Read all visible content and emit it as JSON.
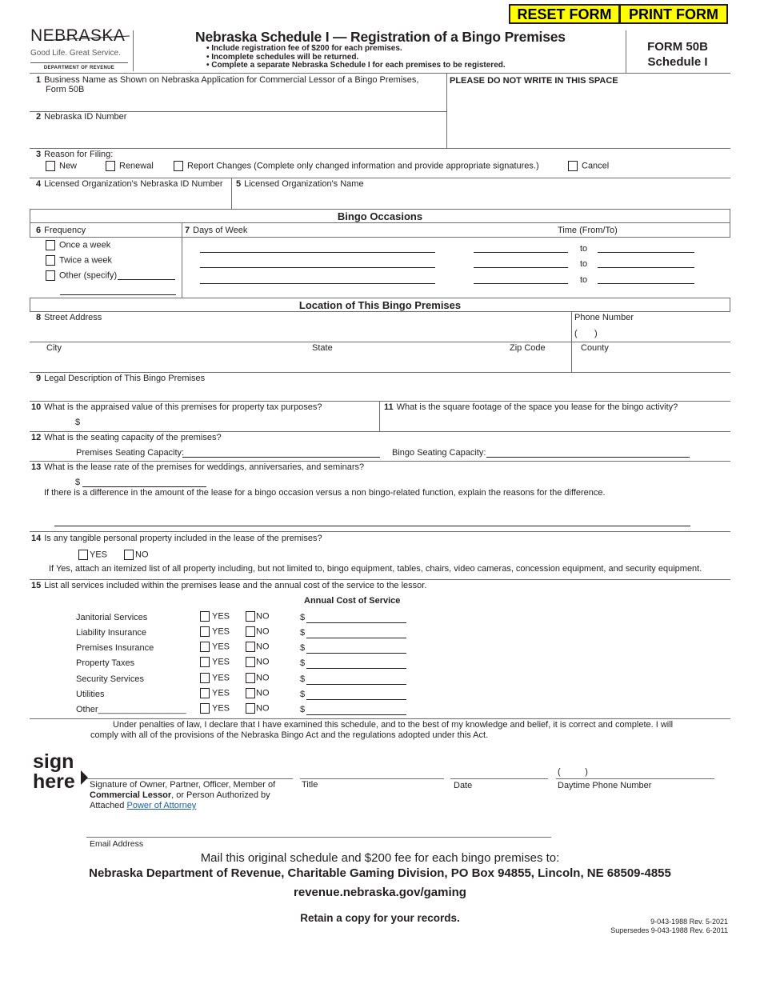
{
  "toolbar": {
    "reset_label": "RESET FORM",
    "print_label": "PRINT FORM",
    "button_color": "#ffff00"
  },
  "header": {
    "logo_text": "NEBRASKA",
    "logo_tagline": "Good Life. Great Service.",
    "logo_dept": "DEPARTMENT OF REVENUE",
    "title": "Nebraska Schedule I — Registration of a Bingo Premises",
    "bullets": [
      "Include registration fee of $200 for each premises.",
      "Incomplete schedules will be returned.",
      "Complete a separate Nebraska Schedule I for each premises to be registered."
    ],
    "form_number": "FORM 50B",
    "form_schedule": "Schedule I"
  },
  "fields": {
    "f1": {
      "num": "1",
      "label": "Business Name as Shown on Nebraska Application for Commercial Lessor of a Bingo Premises,",
      "label2": "Form 50B",
      "value": ""
    },
    "office_use": "PLEASE DO NOT WRITE IN THIS SPACE",
    "f2": {
      "num": "2",
      "label": "Nebraska ID Number",
      "value": ""
    },
    "f3": {
      "num": "3",
      "label": "Reason for Filing:",
      "options": [
        {
          "label": "New",
          "checked": false
        },
        {
          "label": "Renewal",
          "checked": false
        },
        {
          "label": "Report Changes (Complete only changed information and provide appropriate signatures.)",
          "checked": false
        },
        {
          "label": "Cancel",
          "checked": false
        }
      ]
    },
    "f4": {
      "num": "4",
      "label": "Licensed Organization's Nebraska ID Number",
      "value": ""
    },
    "f5": {
      "num": "5",
      "label": "Licensed Organization's Name",
      "value": ""
    }
  },
  "bingo_occasions": {
    "heading": "Bingo Occasions",
    "f6": {
      "num": "6",
      "label": "Frequency",
      "options": [
        {
          "label": "Once a week",
          "checked": false
        },
        {
          "label": "Twice a week",
          "checked": false
        },
        {
          "label": "Other (specify)",
          "checked": false
        }
      ]
    },
    "f7": {
      "num": "7",
      "label": "Days of Week"
    },
    "time_label": "Time (From/To)",
    "to_label": "to"
  },
  "location": {
    "heading": "Location of This Bingo Premises",
    "f8": {
      "num": "8",
      "label": "Street Address",
      "value": ""
    },
    "phone_label": "Phone Number",
    "phone_parens": "(       )",
    "city_label": "City",
    "state_label": "State",
    "zip_label": "Zip Code",
    "county_label": "County",
    "f9": {
      "num": "9",
      "label": "Legal Description of This Bingo Premises"
    },
    "f10": {
      "num": "10",
      "label": "What is the appraised value of this premises for property tax purposes?",
      "currency": "$"
    },
    "f11": {
      "num": "11",
      "label": "What is the square footage of the space you lease for the bingo activity?"
    },
    "f12": {
      "num": "12",
      "label": "What is the seating capacity of the premises?",
      "premises_label": "Premises Seating Capacity:",
      "bingo_label": "Bingo Seating Capacity:"
    },
    "f13": {
      "num": "13",
      "label": "What is the lease rate of the premises for weddings, anniversaries, and seminars?",
      "currency": "$",
      "explain": "If there is a difference in the amount of the lease for a bingo occasion versus a non bingo-related function, explain the reasons for the difference."
    },
    "f14": {
      "num": "14",
      "label": "Is any tangible personal property included in the lease of the premises?",
      "yes": "YES",
      "no": "NO",
      "note": "If Yes, attach an itemized list of all property including, but not limited to, bingo equipment, tables, chairs, video cameras, concession equipment, and security equipment."
    },
    "f15": {
      "num": "15",
      "label": "List all services included within the premises lease and the annual cost of the service to the lessor.",
      "cost_header": "Annual Cost of Service",
      "yes": "YES",
      "no": "NO",
      "currency": "$",
      "services": [
        "Janitorial Services",
        "Liability Insurance",
        "Premises Insurance",
        "Property Taxes",
        "Security Services",
        "Utilities",
        "Other__________________"
      ]
    }
  },
  "signature": {
    "declaration": "Under penalties of law, I declare that I have examined this schedule, and to the best of my knowledge and belief, it is correct and complete. I will",
    "declaration2": "comply with all of the provisions of the Nebraska Bingo Act and the regulations adopted under this Act.",
    "sign": "sign",
    "here": "here",
    "sig_label1": "Signature of Owner, Partner, Officer, Member of",
    "sig_label2_bold": "Commercial Lessor",
    "sig_label2_rest": ", or Person Authorized by",
    "sig_label3": "Attached ",
    "poa_link": "Power of Attorney",
    "title_label": "Title",
    "date_label": "Date",
    "phone_parens": "(          )",
    "phone_label": "Daytime Phone Number",
    "email_label": "Email Address"
  },
  "footer": {
    "mail_line": "Mail this original schedule and $200 fee for each bingo premises to:",
    "address": "Nebraska Department of Revenue, Charitable Gaming Division, PO Box 94855, Lincoln, NE 68509-4855",
    "website": "revenue.nebraska.gov/gaming",
    "retain": "Retain a copy for your records.",
    "rev": "9-043-1988 Rev. 5-2021",
    "supersedes": "Supersedes 9-043-1988 Rev. 6-2011"
  }
}
